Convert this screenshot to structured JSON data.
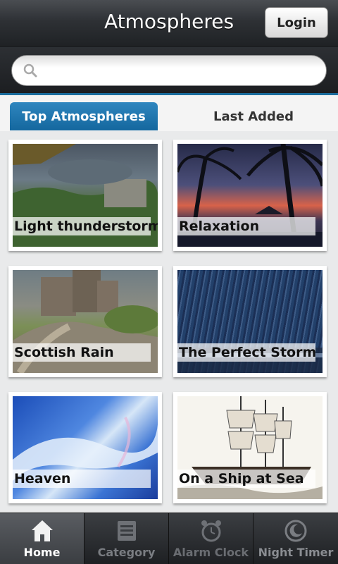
{
  "header": {
    "title": "Atmospheres",
    "login_label": "Login"
  },
  "search": {
    "placeholder": ""
  },
  "tabs": [
    {
      "label": "Top Atmospheres",
      "active": true
    },
    {
      "label": "Last Added",
      "active": false
    }
  ],
  "tiles": [
    {
      "label": "Light thunderstorm"
    },
    {
      "label": "Relaxation"
    },
    {
      "label": "Scottish Rain"
    },
    {
      "label": "The Perfect Storm"
    },
    {
      "label": "Heaven"
    },
    {
      "label": "On a Ship at Sea"
    }
  ],
  "nav": [
    {
      "label": "Home",
      "icon": "home-icon",
      "active": true
    },
    {
      "label": "Category",
      "icon": "category-icon",
      "active": false
    },
    {
      "label": "Alarm Clock",
      "icon": "alarm-clock-icon",
      "active": false
    },
    {
      "label": "Night Timer",
      "icon": "night-timer-icon",
      "active": false
    }
  ],
  "colors": {
    "accent": "#1b6d9e",
    "header": "#2e3135"
  }
}
